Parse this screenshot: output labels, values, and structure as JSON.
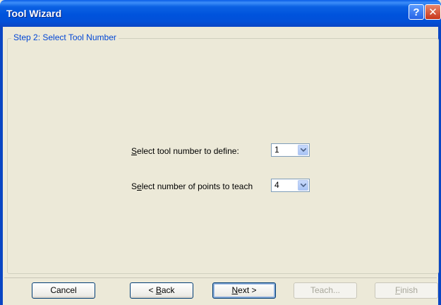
{
  "window": {
    "title": "Tool Wizard",
    "help_label": "?",
    "close_label": "✕"
  },
  "step": {
    "title": "Step 2: Select Tool Number"
  },
  "fields": {
    "tool_number": {
      "label": "Select tool number to define:",
      "value": "1"
    },
    "points": {
      "label": "Select number of points to teach",
      "value": "4"
    }
  },
  "buttons": {
    "cancel": "Cancel",
    "back": "< Back",
    "next": "Next >",
    "teach": "Teach...",
    "finish": "Finish"
  },
  "icons": {
    "help": "help-icon",
    "close": "close-icon",
    "dropdown": "chevron-down-icon"
  }
}
